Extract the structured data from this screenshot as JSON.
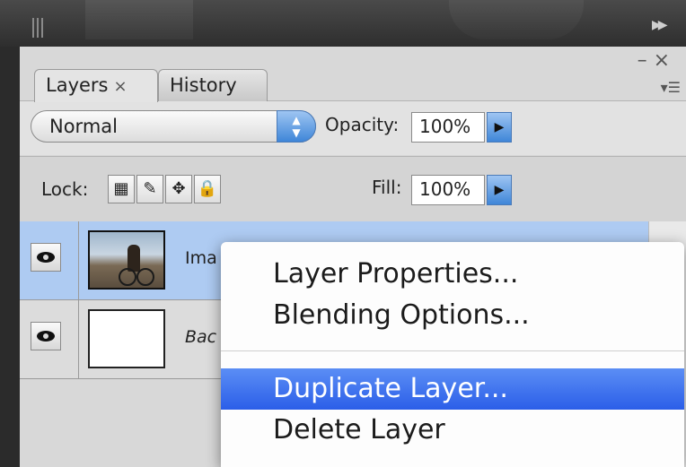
{
  "tabs": [
    {
      "label": "Layers",
      "close": "×"
    },
    {
      "label": "History"
    }
  ],
  "panel_controls": {
    "minimize": "–",
    "close": "×",
    "menu": "▾☰"
  },
  "blend_mode": {
    "value": "Normal"
  },
  "opacity": {
    "label": "Opacity:",
    "value": "100%"
  },
  "lock": {
    "label": "Lock:"
  },
  "fill": {
    "label": "Fill:",
    "value": "100%"
  },
  "layers": [
    {
      "name": "Ima",
      "selected": true
    },
    {
      "name": "Bac",
      "selected": false
    }
  ],
  "context_menu": {
    "items": [
      {
        "label": "Layer Properties..."
      },
      {
        "label": "Blending Options..."
      },
      {
        "label": "Duplicate Layer...",
        "highlighted": true
      },
      {
        "label": "Delete Layer"
      }
    ]
  },
  "colors": {
    "selection_blue": "#aecbf2",
    "menu_highlight": "#2b5ee8"
  }
}
